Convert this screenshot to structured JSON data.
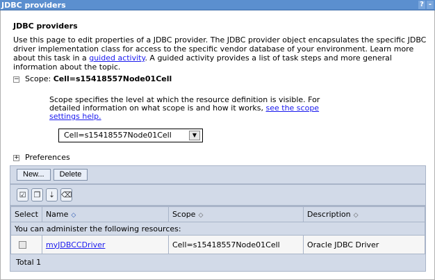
{
  "window": {
    "title": "JDBC providers",
    "help_icon": "?",
    "minimize_icon": "-"
  },
  "page": {
    "heading": "JDBC providers",
    "description_pre": "Use this page to edit properties of a JDBC provider. The JDBC provider object encapsulates the specific JDBC driver implementation class for access to the specific vendor database of your environment. Learn more about this task in a ",
    "description_link": "guided activity",
    "description_post": ". A guided activity provides a list of task steps and more general information about the topic."
  },
  "scope": {
    "label": "Scope: ",
    "value": "Cell=s15418557Node01Cell",
    "help_pre": "Scope specifies the level at which the resource definition is visible. For detailed information on what scope is and how it works, ",
    "help_link": "see the scope settings help.",
    "selected": "Cell=s15418557Node01Cell"
  },
  "preferences": {
    "label": "Preferences"
  },
  "toolbar": {
    "new_label": "New...",
    "delete_label": "Delete"
  },
  "icons": [
    "select-all-icon",
    "deselect-all-icon",
    "show-filter-icon",
    "clear-filter-icon"
  ],
  "table": {
    "headers": [
      "Select",
      "Name",
      "Scope",
      "Description"
    ],
    "info": "You can administer the following resources:",
    "rows": [
      {
        "name": "myJDBCCDriver",
        "scope": "Cell=s15418557Node01Cell",
        "description": "Oracle JDBC Driver",
        "selected": false
      }
    ],
    "total": "Total 1"
  }
}
